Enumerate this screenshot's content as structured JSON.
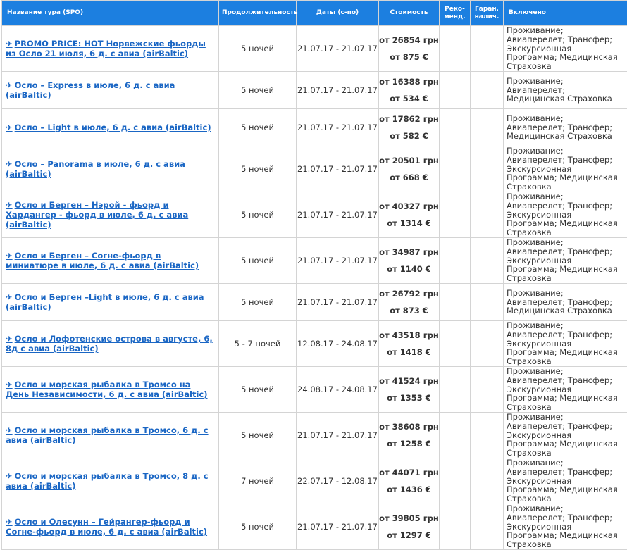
{
  "headers": {
    "name": "Название тура (SPO)",
    "duration": "Продолжительность",
    "dates": "Даты (с-по)",
    "price": "Стоимость",
    "recommended": "Реко-\nменд.",
    "guaranteed": "Гаран.\nналич.",
    "included": "Включено"
  },
  "icons": {
    "tour_link": "airplane-icon"
  },
  "plane_glyph": "✈",
  "colors": {
    "header_bg": "#1c7fe0",
    "link": "#1a66c4"
  },
  "rows": [
    {
      "name": "PROMO PRICE: HOT Норвежские фьорды из Осло 21 июля, 6 д. с авиа (airBaltic)",
      "duration": "5 ночей",
      "dates": "21.07.17 - 21.07.17",
      "price_uah": "от 26854 грн",
      "price_eur": "от 875 €",
      "included": "Проживание; Авиаперелет; Трансфер; Экскурсионная Программа; Медицинская Страховка"
    },
    {
      "name": "Осло – Express в июле, 6 д. с авиа (airBaltic)",
      "duration": "5 ночей",
      "dates": "21.07.17 - 21.07.17",
      "price_uah": "от 16388 грн",
      "price_eur": "от 534 €",
      "included": "Проживание; Авиаперелет; Медицинская Страховка"
    },
    {
      "name": "Осло – Light в июле, 6 д. с авиа (airBaltic)",
      "duration": "5 ночей",
      "dates": "21.07.17 - 21.07.17",
      "price_uah": "от 17862 грн",
      "price_eur": "от 582 €",
      "included": "Проживание; Авиаперелет; Трансфер; Медицинская Страховка"
    },
    {
      "name": "Осло – Panorama в июле, 6 д. с авиа (airBaltic)",
      "duration": "5 ночей",
      "dates": "21.07.17 - 21.07.17",
      "price_uah": "от 20501 грн",
      "price_eur": "от 668 €",
      "included": "Проживание; Авиаперелет; Трансфер; Экскурсионная Программа; Медицинская Страховка"
    },
    {
      "name": "Осло и Берген – Нэрой - фьорд и Хардангер - фьорд в июле, 6 д. с авиа (airBaltic)",
      "duration": "5 ночей",
      "dates": "21.07.17 - 21.07.17",
      "price_uah": "от 40327 грн",
      "price_eur": "от 1314 €",
      "included": "Проживание; Авиаперелет; Трансфер; Экскурсионная Программа; Медицинская Страховка"
    },
    {
      "name": "Осло и Берген – Согне-фьорд в миниатюре в июле, 6 д. с авиа (airBaltic)",
      "duration": "5 ночей",
      "dates": "21.07.17 - 21.07.17",
      "price_uah": "от 34987 грн",
      "price_eur": "от 1140 €",
      "included": "Проживание; Авиаперелет; Трансфер; Экскурсионная Программа; Медицинская Страховка"
    },
    {
      "name": "Осло и Берген –Light в июле, 6 д. с авиа (airBaltic)",
      "duration": "5 ночей",
      "dates": "21.07.17 - 21.07.17",
      "price_uah": "от 26792 грн",
      "price_eur": "от 873 €",
      "included": "Проживание; Авиаперелет; Трансфер; Медицинская Страховка"
    },
    {
      "name": "Осло и Лофотенские острова в августе, 6, 8д с авиа (airBaltic)",
      "duration": "5 - 7 ночей",
      "dates": "12.08.17 - 24.08.17",
      "price_uah": "от 43518 грн",
      "price_eur": "от 1418 €",
      "included": "Проживание; Авиаперелет; Трансфер; Экскурсионная Программа; Медицинская Страховка"
    },
    {
      "name": "Осло и морская рыбалка в Тромсо на День Независимости, 6 д. с авиа (airBaltic)",
      "duration": "5 ночей",
      "dates": "24.08.17 - 24.08.17",
      "price_uah": "от 41524 грн",
      "price_eur": "от 1353 €",
      "included": "Проживание; Авиаперелет; Трансфер; Экскурсионная Программа; Медицинская Страховка"
    },
    {
      "name": "Осло и морская рыбалка в Тромсо, 6 д. с авиа (airBaltic)",
      "duration": "5 ночей",
      "dates": "21.07.17 - 21.07.17",
      "price_uah": "от 38608 грн",
      "price_eur": "от 1258 €",
      "included": "Проживание; Авиаперелет; Трансфер; Экскурсионная Программа; Медицинская Страховка"
    },
    {
      "name": "Осло и морская рыбалка в Тромсо, 8 д. с авиа (airBaltic)",
      "duration": "7 ночей",
      "dates": "22.07.17 - 12.08.17",
      "price_uah": "от 44071 грн",
      "price_eur": "от 1436 €",
      "included": "Проживание; Авиаперелет; Трансфер; Экскурсионная Программа; Медицинская Страховка"
    },
    {
      "name": "Осло и Олесунн – Гейрангер-фьорд  и Согне-фьорд в июле, 6 д. с авиа (airBaltic)",
      "duration": "5 ночей",
      "dates": "21.07.17 - 21.07.17",
      "price_uah": "от 39805 грн",
      "price_eur": "от 1297 €",
      "included": "Проживание; Авиаперелет; Трансфер; Экскурсионная Программа; Медицинская Страховка"
    }
  ]
}
